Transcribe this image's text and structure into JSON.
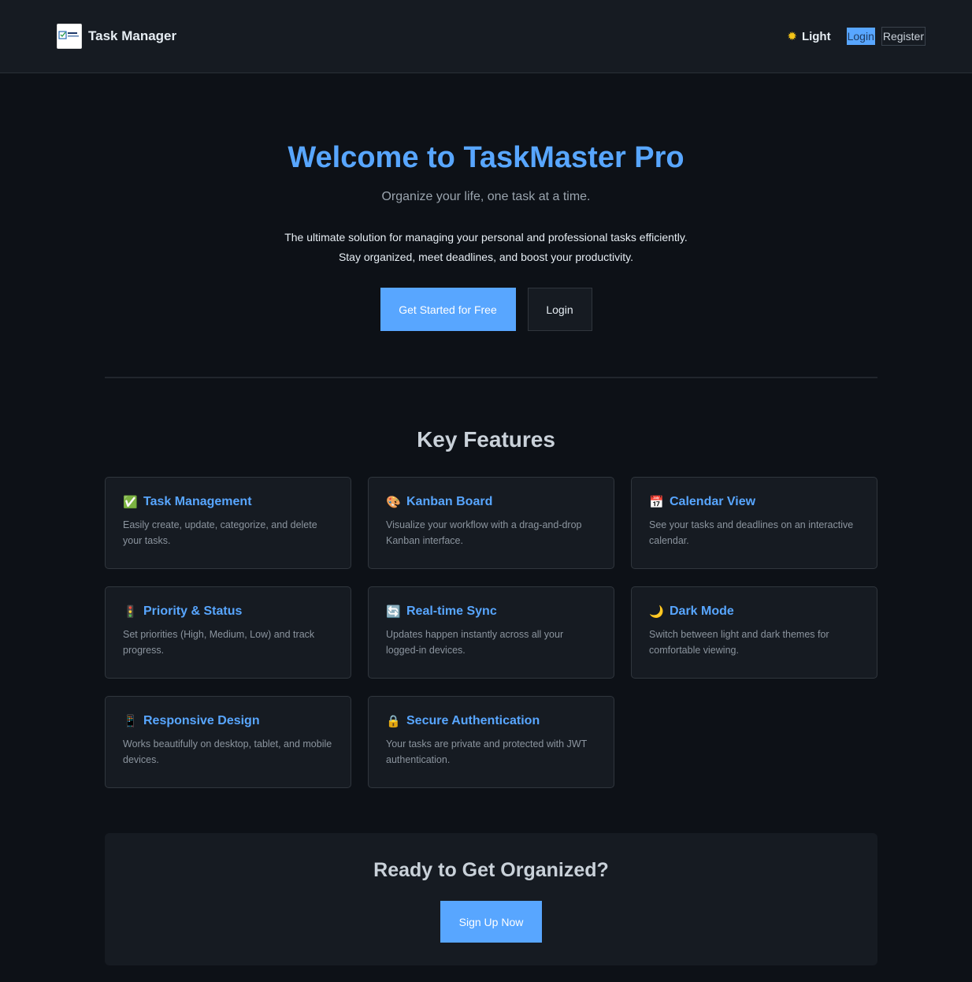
{
  "header": {
    "brand_name": "Task Manager",
    "logo_label": "Task Management",
    "theme_toggle": {
      "icon": "sun-icon",
      "label": "Light"
    },
    "nav": {
      "login": "Login",
      "register": "Register"
    }
  },
  "hero": {
    "title": "Welcome to TaskMaster Pro",
    "tagline": "Organize your life, one task at a time.",
    "description_line1": "The ultimate solution for managing your personal and professional tasks efficiently.",
    "description_line2": "Stay organized, meet deadlines, and boost your productivity.",
    "primary_button": "Get Started for Free",
    "secondary_button": "Login"
  },
  "features": {
    "title": "Key Features",
    "items": [
      {
        "icon": "✅",
        "icon_name": "check-icon",
        "title": "Task Management",
        "description": "Easily create, update, categorize, and delete your tasks."
      },
      {
        "icon": "🎨",
        "icon_name": "palette-icon",
        "title": "Kanban Board",
        "description": "Visualize your workflow with a drag-and-drop Kanban interface."
      },
      {
        "icon": "📅",
        "icon_name": "calendar-icon",
        "title": "Calendar View",
        "description": "See your tasks and deadlines on an interactive calendar."
      },
      {
        "icon": "🚦",
        "icon_name": "traffic-light-icon",
        "title": "Priority & Status",
        "description": "Set priorities (High, Medium, Low) and track progress."
      },
      {
        "icon": "🔄",
        "icon_name": "sync-icon",
        "title": "Real-time Sync",
        "description": "Updates happen instantly across all your logged-in devices."
      },
      {
        "icon": "🌙",
        "icon_name": "moon-icon",
        "title": "Dark Mode",
        "description": "Switch between light and dark themes for comfortable viewing."
      },
      {
        "icon": "📱",
        "icon_name": "mobile-icon",
        "title": "Responsive Design",
        "description": "Works beautifully on desktop, tablet, and mobile devices."
      },
      {
        "icon": "🔒",
        "icon_name": "lock-icon",
        "title": "Secure Authentication",
        "description": "Your tasks are private and protected with JWT authentication."
      }
    ]
  },
  "cta": {
    "title": "Ready to Get Organized?",
    "button": "Sign Up Now"
  },
  "colors": {
    "background": "#0d1117",
    "surface": "#161b22",
    "accent": "#58a6ff"
  }
}
